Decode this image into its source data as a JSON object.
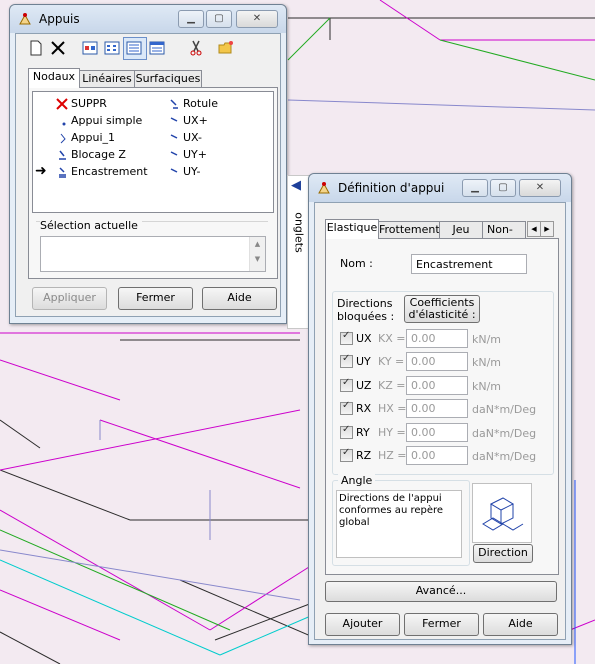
{
  "appuis": {
    "title": "Appuis",
    "tabs": [
      "Nodaux",
      "Linéaires",
      "Surfaciques"
    ],
    "items": [
      {
        "label": "SUPPR",
        "icon": "x-mark-icon"
      },
      {
        "label": "Appui simple",
        "icon": "support-icon"
      },
      {
        "label": "Appui_1",
        "icon": "support-icon"
      },
      {
        "label": "Blocage Z",
        "icon": "support-icon"
      },
      {
        "label": "Encastrement",
        "icon": "support-icon"
      },
      {
        "label": "Rotule",
        "icon": "support-icon"
      },
      {
        "label": "UX+",
        "icon": "support-icon"
      },
      {
        "label": "UX-",
        "icon": "support-icon"
      },
      {
        "label": "UY+",
        "icon": "support-icon"
      },
      {
        "label": "UY-",
        "icon": "support-icon"
      }
    ],
    "selection_label": "Sélection actuelle",
    "buttons": {
      "apply": "Appliquer",
      "close": "Fermer",
      "help": "Aide"
    }
  },
  "side_tab": {
    "label": "onglets"
  },
  "definition": {
    "title": "Définition d'appui",
    "tabs": [
      "Elastique",
      "Frottement",
      "Jeu",
      "Non-lin"
    ],
    "name_label": "Nom :",
    "name_value": "Encastrement",
    "blocked_label_1": "Directions",
    "blocked_label_2": "bloquées :",
    "coef_btn_1": "Coefficients",
    "coef_btn_2": "d'élasticité :",
    "rows": [
      {
        "dir": "UX",
        "coef": "KX =",
        "value": "0.00",
        "unit": "kN/m",
        "checked": true
      },
      {
        "dir": "UY",
        "coef": "KY =",
        "value": "0.00",
        "unit": "kN/m",
        "checked": true
      },
      {
        "dir": "UZ",
        "coef": "KZ =",
        "value": "0.00",
        "unit": "kN/m",
        "checked": true
      },
      {
        "dir": "RX",
        "coef": "HX =",
        "value": "0.00",
        "unit": "daN*m/Deg",
        "checked": true
      },
      {
        "dir": "RY",
        "coef": "HY =",
        "value": "0.00",
        "unit": "daN*m/Deg",
        "checked": true
      },
      {
        "dir": "RZ",
        "coef": "HZ =",
        "value": "0.00",
        "unit": "daN*m/Deg",
        "checked": true
      }
    ],
    "angle_label": "Angle",
    "angle_text_1": "Directions de l'appui",
    "angle_text_2": "conformes au repère",
    "angle_text_3": "global",
    "direction_btn": "Direction",
    "advanced_btn": "Avancé...",
    "buttons": {
      "add": "Ajouter",
      "close": "Fermer",
      "help": "Aide"
    }
  }
}
